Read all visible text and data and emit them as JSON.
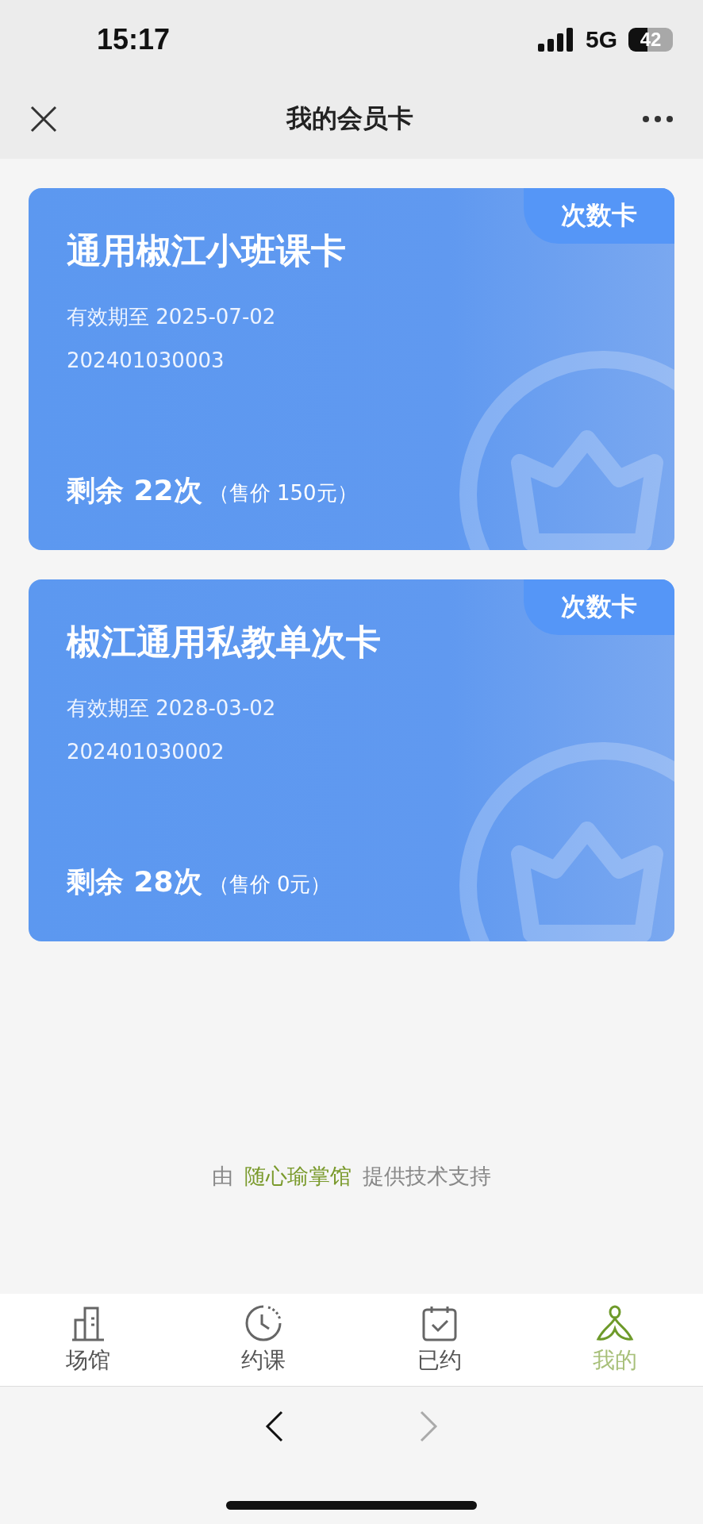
{
  "status_bar": {
    "time": "15:17",
    "network": "5G",
    "battery": "42"
  },
  "nav_bar": {
    "title": "我的会员卡"
  },
  "cards": [
    {
      "tag": "次数卡",
      "name": "通用椒江小班课卡",
      "validity": "有效期至 2025-07-02",
      "number": "202401030003",
      "remaining": "剩余 22次",
      "price": "（售价 150元）"
    },
    {
      "tag": "次数卡",
      "name": "椒江通用私教单次卡",
      "validity": "有效期至 2028-03-02",
      "number": "202401030002",
      "remaining": "剩余 28次",
      "price": "（售价 0元）"
    }
  ],
  "footer": {
    "prefix": "由",
    "brand": "随心瑜掌馆",
    "suffix": "提供技术支持"
  },
  "tabs": [
    {
      "kind": "venue",
      "label": "场馆",
      "selected": false
    },
    {
      "kind": "booking",
      "label": "约课",
      "selected": false
    },
    {
      "kind": "booked",
      "label": "已约",
      "selected": false
    },
    {
      "kind": "mine",
      "label": "我的",
      "selected": true
    }
  ],
  "browser_nav": {
    "back": {
      "disabled": false
    },
    "forward": {
      "disabled": true
    }
  }
}
